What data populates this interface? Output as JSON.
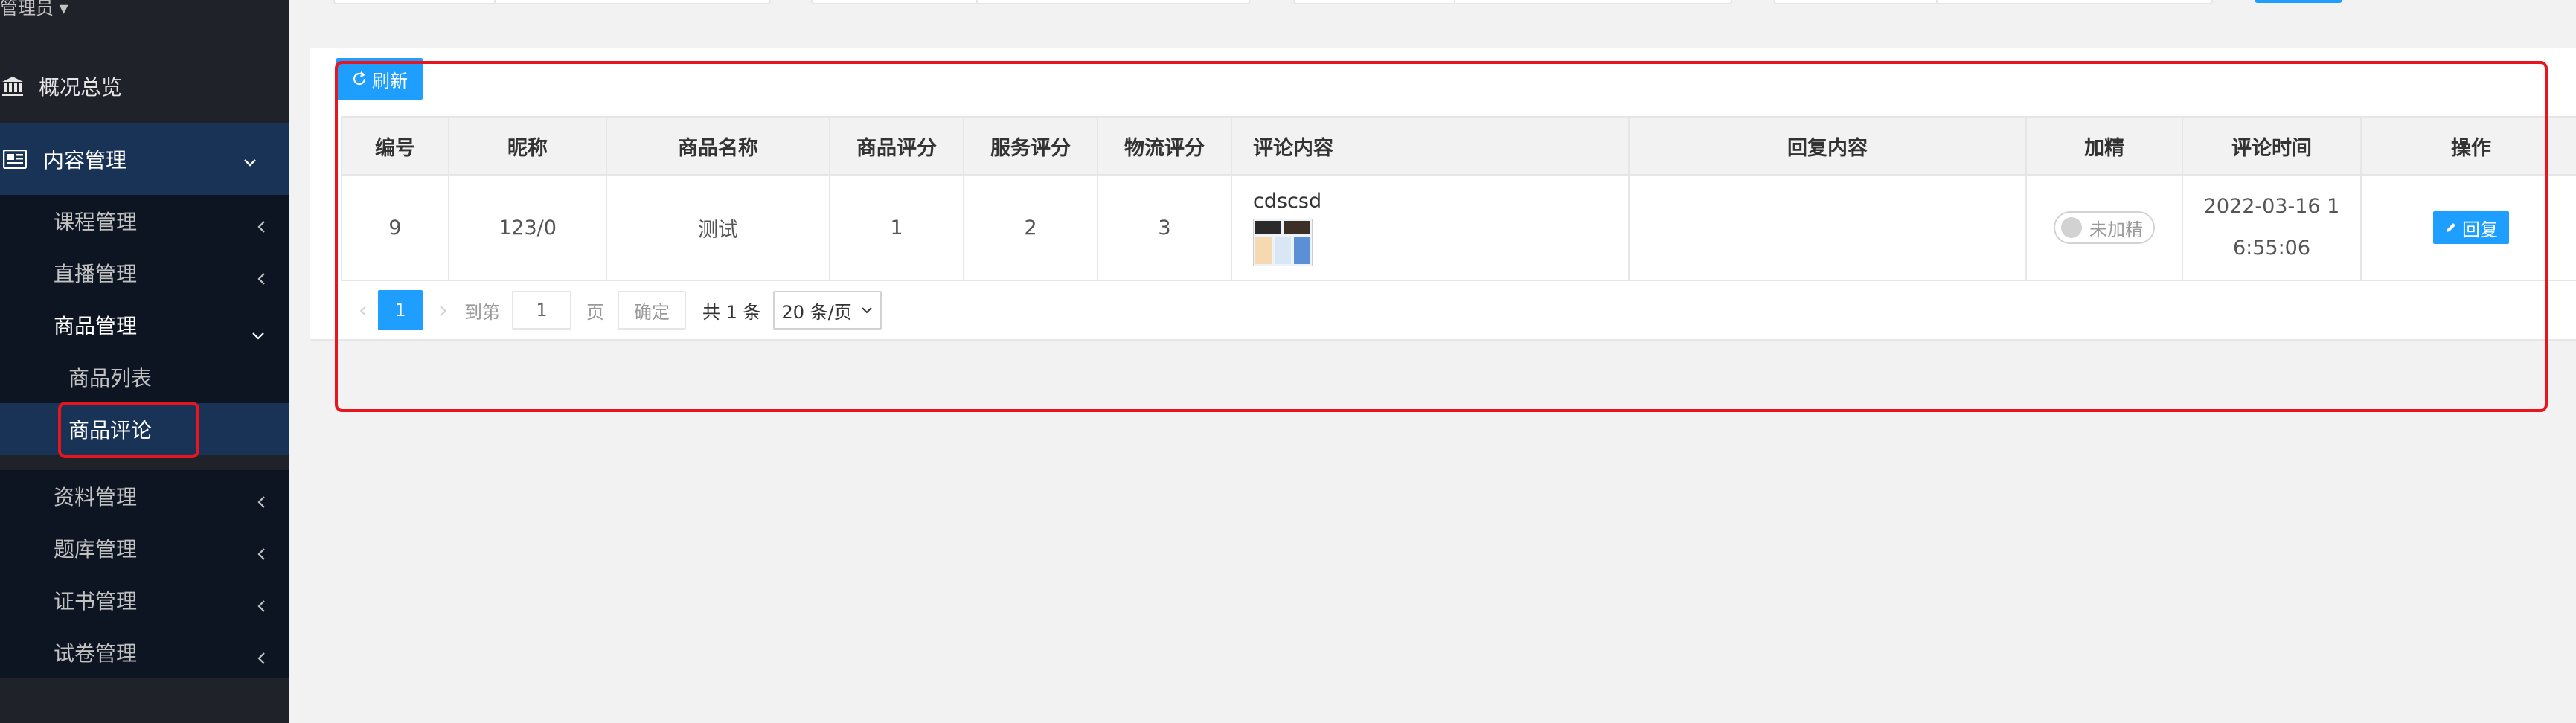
{
  "sidebar": {
    "user_label": "管理员",
    "top_item": {
      "label": "概况总览",
      "icon": "bank-icon"
    },
    "content_menu": {
      "label": "内容管理",
      "icon": "newspaper-icon"
    },
    "submenu": [
      {
        "label": "课程管理"
      },
      {
        "label": "直播管理"
      },
      {
        "label": "商品管理"
      },
      {
        "label": "资料管理"
      },
      {
        "label": "题库管理"
      },
      {
        "label": "证书管理"
      },
      {
        "label": "试卷管理"
      }
    ],
    "goods_children": [
      {
        "label": "商品列表"
      },
      {
        "label": "商品评论"
      }
    ]
  },
  "toolbar": {
    "refresh_label": "刷新"
  },
  "table": {
    "headers": [
      "编号",
      "昵称",
      "商品名称",
      "商品评分",
      "服务评分",
      "物流评分",
      "评论内容",
      "回复内容",
      "加精",
      "评论时间",
      "操作"
    ],
    "rows": [
      {
        "id": "9",
        "nickname": "123/0",
        "product": "测试",
        "product_score": "1",
        "service_score": "2",
        "logistics_score": "3",
        "comment": "cdscsd",
        "reply": "",
        "featured": "未加精",
        "time_line1": "2022-03-16 1",
        "time_line2": "6:55:06",
        "action": "回复"
      }
    ]
  },
  "pager": {
    "current": "1",
    "goto_label": "到第",
    "goto_value": "1",
    "page_label": "页",
    "ok_label": "确定",
    "total_label": "共 1 条",
    "page_size": "20 条/页"
  },
  "colors": {
    "primary": "#1e9fff",
    "sidebar": "#20222a",
    "highlight": "#e8141e"
  }
}
